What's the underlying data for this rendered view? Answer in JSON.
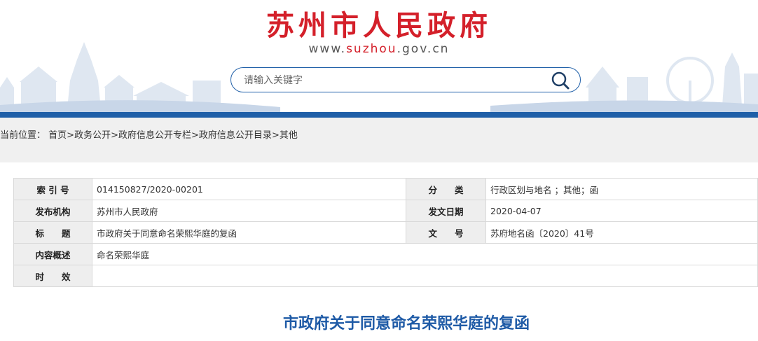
{
  "header": {
    "site_title": "苏州市人民政府",
    "url_prefix": "www.",
    "url_mid": "suzhou",
    "url_suffix": ".gov.cn",
    "accent_color": "#d4202a",
    "brand_blue": "#1f5fa8"
  },
  "search": {
    "placeholder": "请输入关键字",
    "icon": "search-icon"
  },
  "breadcrumb": {
    "prefix": "当前位置：",
    "items": [
      "首页",
      "政务公开",
      "政府信息公开专栏",
      "政府信息公开目录",
      "其他"
    ],
    "separator": ">"
  },
  "info": {
    "index_label": "索 引 号",
    "index_value": "014150827/2020-00201",
    "category_label": "分　　类",
    "category_value": "行政区划与地名 ；其他；函",
    "issuer_label": "发布机构",
    "issuer_value": "苏州市人民政府",
    "date_label": "发文日期",
    "date_value": "2020-04-07",
    "title_label": "标　　题",
    "title_value": "市政府关于同意命名荣熙华庭的复函",
    "docno_label": "文　　号",
    "docno_value": "苏府地名函〔2020〕41号",
    "summary_label": "内容概述",
    "summary_value": "命名荣熙华庭",
    "validity_label": "时　　效",
    "validity_value": ""
  },
  "article": {
    "title": "市政府关于同意命名荣熙华庭的复函"
  }
}
